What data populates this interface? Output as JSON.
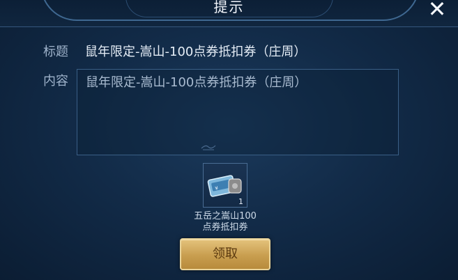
{
  "dialog": {
    "title": "提示",
    "close_icon": "close-icon"
  },
  "mail": {
    "subject_label": "标题",
    "subject": "鼠年限定-嵩山-100点券抵扣券（庄周）",
    "content_label": "内容",
    "content": "鼠年限定-嵩山-100点券抵扣券（庄周）"
  },
  "attachment": {
    "icon": "voucher-ticket-icon",
    "count": "1",
    "name": "五岳之嵩山100点券抵扣券"
  },
  "actions": {
    "claim_label": "领取"
  },
  "colors": {
    "background": "#122b48",
    "button_gold": "#c89e4f",
    "border_blue": "#3a5f86"
  }
}
